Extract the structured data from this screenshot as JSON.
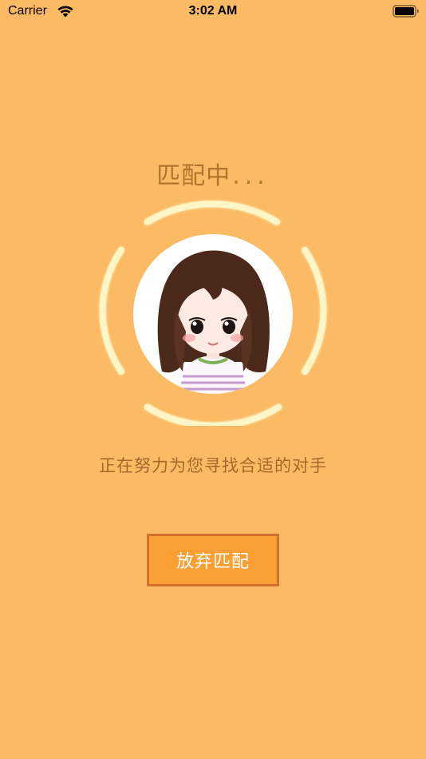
{
  "status_bar": {
    "carrier": "Carrier",
    "time": "3:02 AM",
    "wifi_icon": "wifi-icon",
    "battery_icon": "battery-icon"
  },
  "matching": {
    "title": "匹配中",
    "dots": "...",
    "subtitle": "正在努力为您寻找合适的对手",
    "cancel_label": "放弃匹配",
    "avatar_icon": "avatar-girl-illustration"
  },
  "colors": {
    "background": "#FBBA63",
    "ring": "#FFF6C8",
    "title_text": "#B5742B",
    "button_fill": "#FA9F33",
    "button_border": "#D2702F"
  }
}
